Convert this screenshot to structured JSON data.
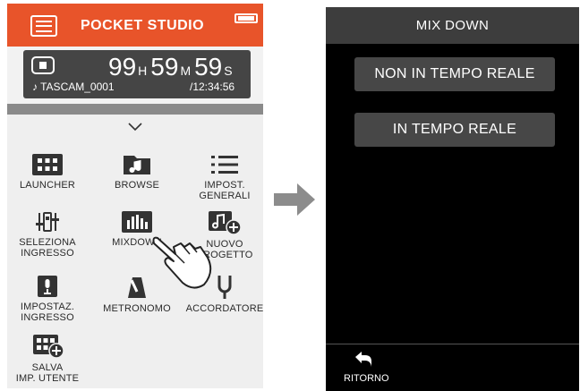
{
  "left": {
    "header": {
      "title": "POCKET STUDIO"
    },
    "counter": {
      "hours": "99",
      "hours_unit": "H",
      "minutes": "59",
      "minutes_unit": "M",
      "seconds": "59",
      "seconds_unit": "S",
      "file_name": "♪ TASCAM_0001",
      "total_time": "/12:34:56"
    },
    "menu": {
      "items": [
        {
          "label_1": "LAUNCHER",
          "label_2": "",
          "icon": "launcher-grid-icon"
        },
        {
          "label_1": "BROWSE",
          "label_2": "",
          "icon": "music-folder-icon"
        },
        {
          "label_1": "IMPOST.",
          "label_2": "GENERALI",
          "icon": "list-icon"
        },
        {
          "label_1": "SELEZIONA",
          "label_2": "INGRESSO",
          "icon": "input-select-icon"
        },
        {
          "label_1": "MIXDOWN",
          "label_2": "",
          "icon": "mixdown-icon"
        },
        {
          "label_1": "NUOVO",
          "label_2": "PROGETTO",
          "icon": "new-project-icon"
        },
        {
          "label_1": "IMPOSTAZ.",
          "label_2": "INGRESSO",
          "icon": "microphone-icon"
        },
        {
          "label_1": "METRONOMO",
          "label_2": "",
          "icon": "metronome-icon"
        },
        {
          "label_1": "ACCORDATORE",
          "label_2": "",
          "icon": "tuning-fork-icon"
        },
        {
          "label_1": "SALVA",
          "label_2": "IMP. UTENTE",
          "icon": "save-user-icon"
        }
      ]
    }
  },
  "right": {
    "header": {
      "title": "MIX DOWN"
    },
    "options": [
      {
        "label": "NON IN TEMPO REALE"
      },
      {
        "label": "IN TEMPO REALE"
      }
    ],
    "footer": {
      "back_label": "RITORNO"
    }
  },
  "colors": {
    "accent": "#e8542a",
    "panel": "#454545",
    "button": "#474747",
    "right_bg": "#000000"
  }
}
